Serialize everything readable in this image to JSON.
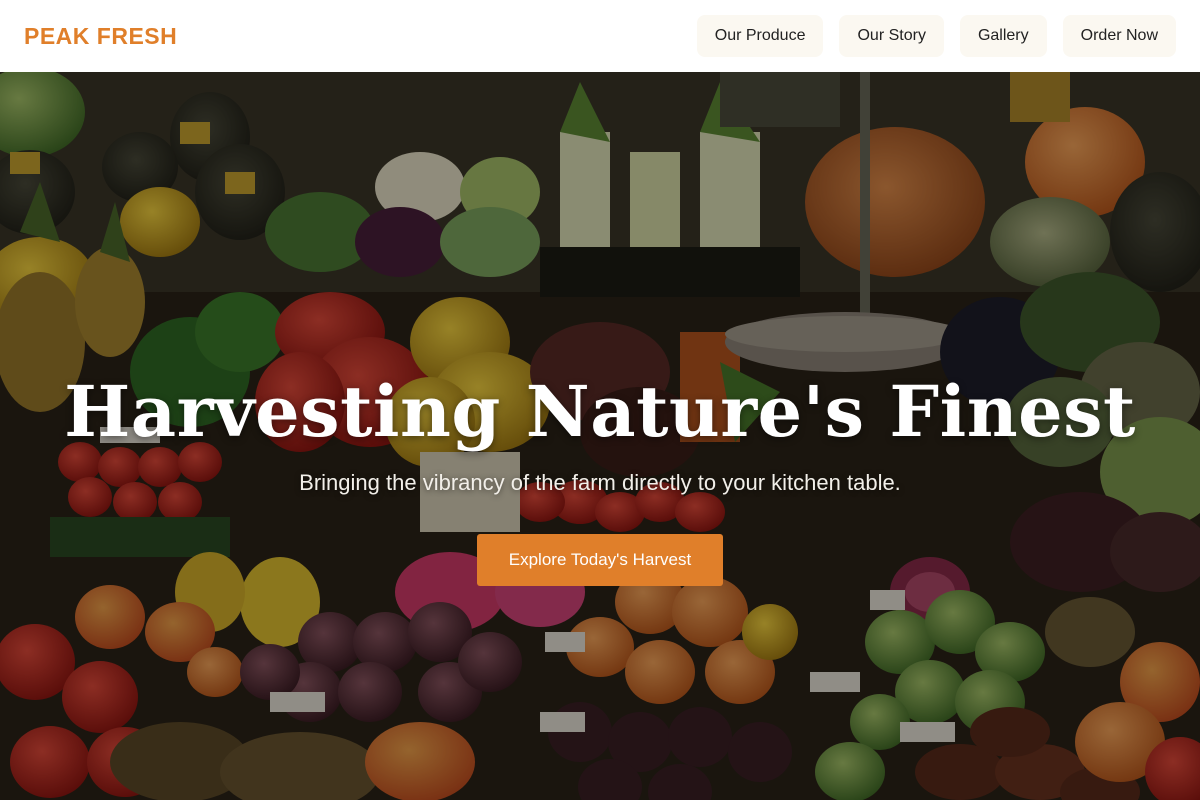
{
  "header": {
    "logo": "PEAK FRESH",
    "nav": [
      {
        "label": "Our Produce"
      },
      {
        "label": "Our Story"
      },
      {
        "label": "Gallery"
      },
      {
        "label": "Order Now"
      }
    ]
  },
  "hero": {
    "title": "Harvesting Nature's Finest",
    "subtitle": "Bringing the vibrancy of the farm directly to your kitchen table.",
    "cta_label": "Explore Today's Harvest"
  },
  "colors": {
    "accent": "#e07f2a",
    "header_bg": "#ffffff",
    "nav_pill_bg": "#fbf8f1"
  },
  "icons": {
    "background": "produce-market-photo"
  }
}
